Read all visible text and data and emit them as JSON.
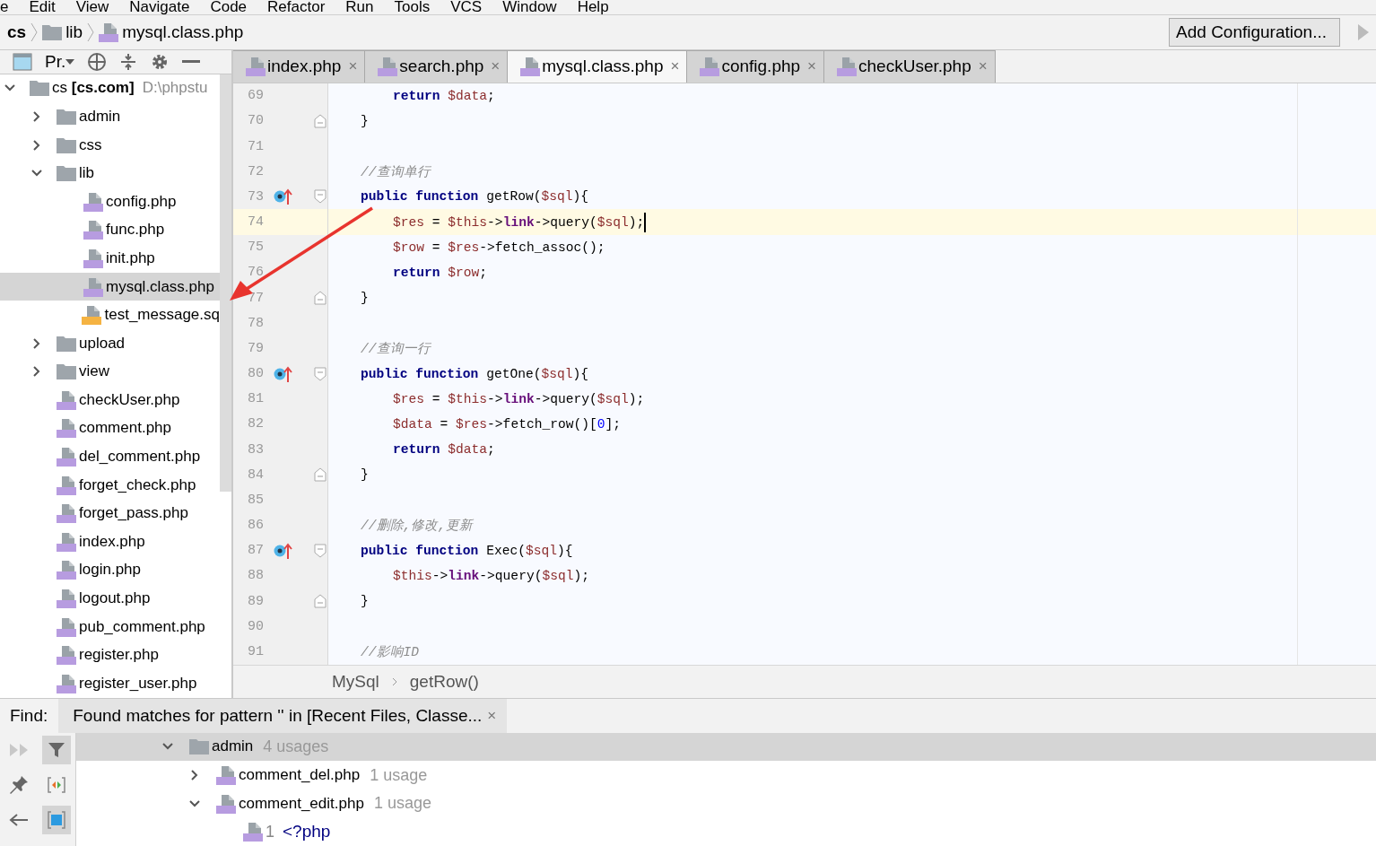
{
  "menu": [
    "e",
    "Edit",
    "View",
    "Navigate",
    "Code",
    "Refactor",
    "Run",
    "Tools",
    "VCS",
    "Window",
    "Help"
  ],
  "nav_bar": {
    "crumbs": [
      {
        "kind": "project",
        "label": "cs"
      },
      {
        "kind": "folder",
        "label": "lib"
      },
      {
        "kind": "php",
        "label": "mysql.class.php"
      }
    ],
    "run_config": "Add Configuration..."
  },
  "project_panel": {
    "title": "Pr.",
    "tree": [
      {
        "kind": "root",
        "label": "cs **[cs.com]**",
        "path": "D:\\phpstu",
        "expanded": true,
        "selected": false,
        "children": [
          {
            "kind": "folder",
            "label": "admin",
            "expanded": false,
            "selected": false
          },
          {
            "kind": "folder",
            "label": "css",
            "expanded": false,
            "selected": false
          },
          {
            "kind": "folder",
            "label": "lib",
            "expanded": true,
            "selected": false,
            "children": [
              {
                "kind": "php",
                "label": "config.php",
                "selected": false
              },
              {
                "kind": "php",
                "label": "func.php",
                "selected": false
              },
              {
                "kind": "php",
                "label": "init.php",
                "selected": false
              },
              {
                "kind": "php",
                "label": "mysql.class.php",
                "selected": true
              },
              {
                "kind": "sql",
                "label": "test_message.sq",
                "selected": false
              }
            ]
          },
          {
            "kind": "folder",
            "label": "upload",
            "expanded": false,
            "selected": false
          },
          {
            "kind": "folder",
            "label": "view",
            "expanded": false,
            "selected": false
          },
          {
            "kind": "php",
            "label": "checkUser.php",
            "selected": false
          },
          {
            "kind": "php",
            "label": "comment.php",
            "selected": false
          },
          {
            "kind": "php",
            "label": "del_comment.php",
            "selected": false
          },
          {
            "kind": "php",
            "label": "forget_check.php",
            "selected": false
          },
          {
            "kind": "php",
            "label": "forget_pass.php",
            "selected": false
          },
          {
            "kind": "php",
            "label": "index.php",
            "selected": false
          },
          {
            "kind": "php",
            "label": "login.php",
            "selected": false
          },
          {
            "kind": "php",
            "label": "logout.php",
            "selected": false
          },
          {
            "kind": "php",
            "label": "pub_comment.php",
            "selected": false
          },
          {
            "kind": "php",
            "label": "register.php",
            "selected": false
          },
          {
            "kind": "php",
            "label": "register_user.php",
            "selected": false
          }
        ]
      }
    ]
  },
  "tabs": [
    {
      "label": "index.php",
      "close": "×",
      "selected": false
    },
    {
      "label": "search.php",
      "close": "×",
      "selected": false
    },
    {
      "label": "mysql.class.php",
      "close": "×",
      "selected": true
    },
    {
      "label": "config.php",
      "close": "×",
      "selected": false
    },
    {
      "label": "checkUser.php",
      "close": "×",
      "selected": false
    }
  ],
  "code_lines": [
    {
      "number": "69",
      "kind": "body",
      "fold_start": false,
      "fold_end": false,
      "override": false,
      "current": false,
      "tokens": [
        {
          "kind": "keyword",
          "text": "return "
        },
        {
          "kind": "variable",
          "text": "$data"
        },
        {
          "kind": "plain",
          "text": ";"
        }
      ]
    },
    {
      "number": "70",
      "kind": "member",
      "fold_start": false,
      "fold_end": true,
      "override": false,
      "current": false,
      "tokens": [
        {
          "kind": "plain",
          "text": "}"
        }
      ]
    },
    {
      "number": "71",
      "fold_start": false,
      "fold_end": false,
      "override": false,
      "current": false
    },
    {
      "number": "72",
      "kind": "member",
      "fold_start": false,
      "fold_end": false,
      "override": false,
      "current": false,
      "tokens": [
        {
          "kind": "comment",
          "text": "//查询单行"
        }
      ]
    },
    {
      "number": "73",
      "kind": "member",
      "fold_start": true,
      "fold_end": false,
      "override": true,
      "current": false,
      "tokens": [
        {
          "kind": "keyword",
          "text": "public function "
        },
        {
          "kind": "plain",
          "text": "getRow("
        },
        {
          "kind": "variable",
          "text": "$sql"
        },
        {
          "kind": "plain",
          "text": "){"
        }
      ]
    },
    {
      "number": "74",
      "kind": "body",
      "fold_start": false,
      "fold_end": false,
      "override": false,
      "current": true,
      "tokens": [
        {
          "kind": "variable",
          "text": "$res"
        },
        {
          "kind": "plain",
          "text": " = "
        },
        {
          "kind": "variable",
          "text": "$this"
        },
        {
          "kind": "plain",
          "text": "->"
        },
        {
          "kind": "field",
          "text": "link"
        },
        {
          "kind": "plain",
          "text": "->query("
        },
        {
          "kind": "variable",
          "text": "$sql"
        },
        {
          "kind": "plain",
          "text": ");"
        }
      ]
    },
    {
      "number": "75",
      "kind": "body",
      "fold_start": false,
      "fold_end": false,
      "override": false,
      "current": false,
      "tokens": [
        {
          "kind": "variable",
          "text": "$row"
        },
        {
          "kind": "plain",
          "text": " = "
        },
        {
          "kind": "variable",
          "text": "$res"
        },
        {
          "kind": "plain",
          "text": "->fetch_assoc();"
        }
      ]
    },
    {
      "number": "76",
      "kind": "body",
      "fold_start": false,
      "fold_end": false,
      "override": false,
      "current": false,
      "tokens": [
        {
          "kind": "keyword",
          "text": "return "
        },
        {
          "kind": "variable",
          "text": "$row"
        },
        {
          "kind": "plain",
          "text": ";"
        }
      ]
    },
    {
      "number": "77",
      "kind": "member",
      "fold_start": false,
      "fold_end": true,
      "override": false,
      "current": false,
      "tokens": [
        {
          "kind": "plain",
          "text": "}"
        }
      ]
    },
    {
      "number": "78",
      "fold_start": false,
      "fold_end": false,
      "override": false,
      "current": false
    },
    {
      "number": "79",
      "kind": "member",
      "fold_start": false,
      "fold_end": false,
      "override": false,
      "current": false,
      "tokens": [
        {
          "kind": "comment",
          "text": "//查询一行"
        }
      ]
    },
    {
      "number": "80",
      "kind": "member",
      "fold_start": true,
      "fold_end": false,
      "override": true,
      "current": false,
      "tokens": [
        {
          "kind": "keyword",
          "text": "public function "
        },
        {
          "kind": "plain",
          "text": "getOne("
        },
        {
          "kind": "variable",
          "text": "$sql"
        },
        {
          "kind": "plain",
          "text": "){"
        }
      ]
    },
    {
      "number": "81",
      "kind": "body",
      "fold_start": false,
      "fold_end": false,
      "override": false,
      "current": false,
      "tokens": [
        {
          "kind": "variable",
          "text": "$res"
        },
        {
          "kind": "plain",
          "text": " = "
        },
        {
          "kind": "variable",
          "text": "$this"
        },
        {
          "kind": "plain",
          "text": "->"
        },
        {
          "kind": "field",
          "text": "link"
        },
        {
          "kind": "plain",
          "text": "->query("
        },
        {
          "kind": "variable",
          "text": "$sql"
        },
        {
          "kind": "plain",
          "text": ");"
        }
      ]
    },
    {
      "number": "82",
      "kind": "body",
      "fold_start": false,
      "fold_end": false,
      "override": false,
      "current": false,
      "tokens": [
        {
          "kind": "variable",
          "text": "$data"
        },
        {
          "kind": "plain",
          "text": " = "
        },
        {
          "kind": "variable",
          "text": "$res"
        },
        {
          "kind": "plain",
          "text": "->fetch_row()["
        },
        {
          "kind": "number",
          "text": "0"
        },
        {
          "kind": "plain",
          "text": "];"
        }
      ]
    },
    {
      "number": "83",
      "kind": "body",
      "fold_start": false,
      "fold_end": false,
      "override": false,
      "current": false,
      "tokens": [
        {
          "kind": "keyword",
          "text": "return "
        },
        {
          "kind": "variable",
          "text": "$data"
        },
        {
          "kind": "plain",
          "text": ";"
        }
      ]
    },
    {
      "number": "84",
      "kind": "member",
      "fold_start": false,
      "fold_end": true,
      "override": false,
      "current": false,
      "tokens": [
        {
          "kind": "plain",
          "text": "}"
        }
      ]
    },
    {
      "number": "85",
      "fold_start": false,
      "fold_end": false,
      "override": false,
      "current": false
    },
    {
      "number": "86",
      "kind": "member",
      "fold_start": false,
      "fold_end": false,
      "override": false,
      "current": false,
      "tokens": [
        {
          "kind": "comment",
          "text": "//删除,修改,更新"
        }
      ]
    },
    {
      "number": "87",
      "kind": "member",
      "fold_start": true,
      "fold_end": false,
      "override": true,
      "current": false,
      "tokens": [
        {
          "kind": "keyword",
          "text": "public function "
        },
        {
          "kind": "plain",
          "text": "Exec("
        },
        {
          "kind": "variable",
          "text": "$sql"
        },
        {
          "kind": "plain",
          "text": "){"
        }
      ]
    },
    {
      "number": "88",
      "kind": "body",
      "fold_start": false,
      "fold_end": false,
      "override": false,
      "current": false,
      "tokens": [
        {
          "kind": "variable",
          "text": "$this"
        },
        {
          "kind": "plain",
          "text": "->"
        },
        {
          "kind": "field",
          "text": "link"
        },
        {
          "kind": "plain",
          "text": "->query("
        },
        {
          "kind": "variable",
          "text": "$sql"
        },
        {
          "kind": "plain",
          "text": ");"
        }
      ]
    },
    {
      "number": "89",
      "kind": "member",
      "fold_start": false,
      "fold_end": true,
      "override": false,
      "current": false,
      "tokens": [
        {
          "kind": "plain",
          "text": "}"
        }
      ]
    },
    {
      "number": "90",
      "fold_start": false,
      "fold_end": false,
      "override": false,
      "current": false
    },
    {
      "number": "91",
      "kind": "member",
      "fold_start": false,
      "fold_end": false,
      "override": false,
      "current": false,
      "tokens": [
        {
          "kind": "comment",
          "text": "//影响ID"
        }
      ]
    }
  ],
  "editor_breadcrumb": [
    "MySql",
    "getRow()"
  ],
  "annotation": {
    "kind": "arrow"
  },
  "find_panel": {
    "label": "Find:",
    "tab": "Found matches for pattern '' in [Recent Files, Classe...",
    "close": "×",
    "results": [
      {
        "kind": "folder",
        "label": "admin",
        "usages": "4 usages",
        "expanded": true,
        "selected": true,
        "children": [
          {
            "kind": "php",
            "label": "comment_del.php",
            "usages": "1 usage",
            "expanded": false,
            "selected": false
          },
          {
            "kind": "php",
            "label": "comment_edit.php",
            "usages": "1 usage",
            "expanded": true,
            "selected": false,
            "children": [
              {
                "kind": "line",
                "line_number": "1",
                "label": "<?php",
                "selected": false
              }
            ]
          }
        ]
      }
    ]
  }
}
